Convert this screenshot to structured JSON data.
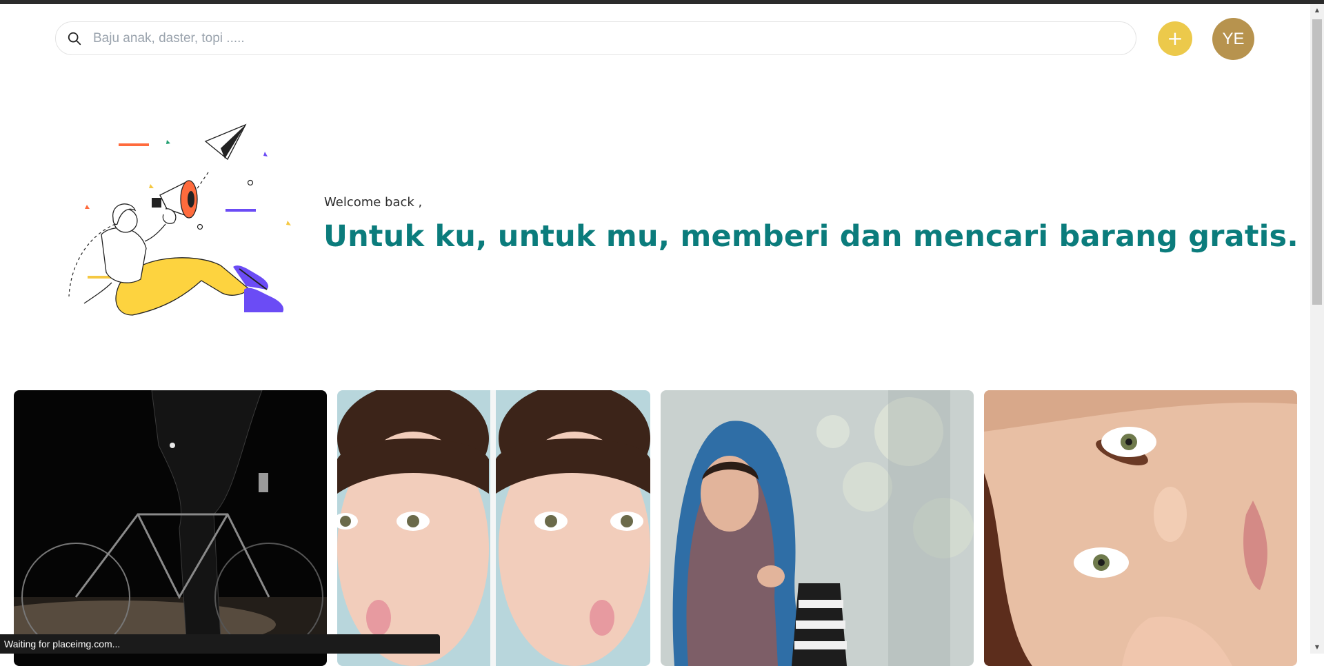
{
  "header": {
    "search_placeholder": "Baju anak, daster, topi .....",
    "add_button_label": "+",
    "avatar_initials": "YE"
  },
  "hero": {
    "welcome": "Welcome back ,",
    "headline": "Untuk ku, untuk mu, memberi dan mencari barang gratis."
  },
  "status_bar": "Waiting for placeimg.com...",
  "colors": {
    "accent_teal": "#0b7c7c",
    "add_button": "#ecc94b",
    "avatar_bg": "#b7934e"
  },
  "icons": [
    "search-icon",
    "plus-icon",
    "megaphone-illustration",
    "paper-plane-icon"
  ]
}
